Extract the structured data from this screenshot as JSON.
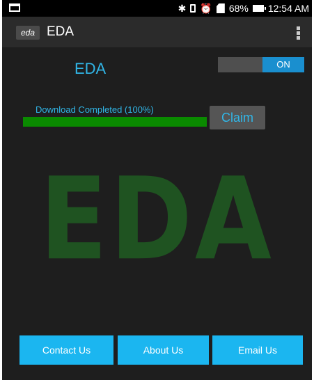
{
  "status_bar": {
    "battery_percent": "68%",
    "time": "12:54 AM",
    "icons": [
      "bluetooth-icon",
      "vibrate-icon",
      "alarm-icon",
      "sd-card-icon",
      "battery-icon"
    ]
  },
  "app_bar": {
    "logo_text": "eda",
    "title": "EDA"
  },
  "main": {
    "heading": "EDA",
    "toggle_label": "ON",
    "download_status": "Download Completed (100%)",
    "progress": 1.0,
    "claim_label": "Claim",
    "watermark": "EDA"
  },
  "buttons": {
    "contact": "Contact Us",
    "about": "About Us",
    "email": "Email Us"
  },
  "colors": {
    "accent": "#31b6e7",
    "button_bg": "#1bb6f0",
    "progress_fill": "#0a8a00",
    "watermark": "#1f5321",
    "background": "#1e1e1e"
  }
}
